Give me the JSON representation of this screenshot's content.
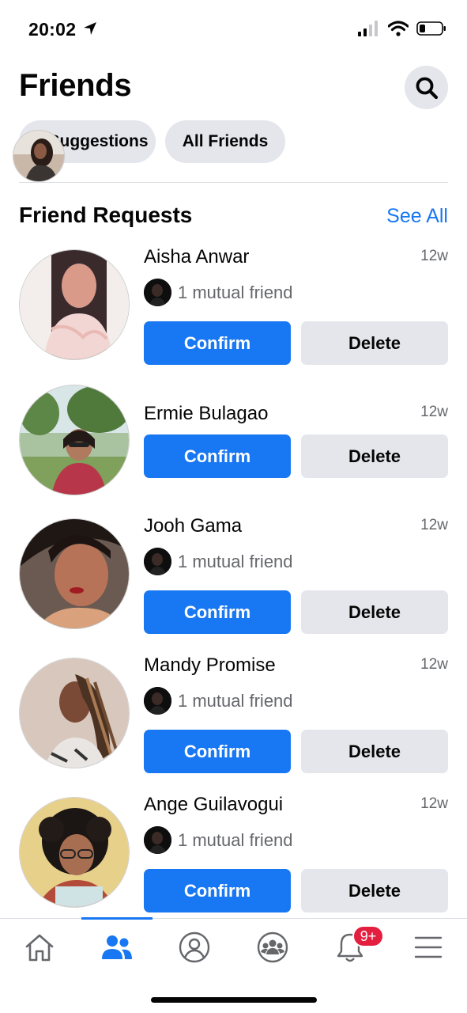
{
  "status_bar": {
    "time": "20:02"
  },
  "header": {
    "title": "Friends"
  },
  "chips": {
    "suggestions": "Suggestions",
    "all_friends": "All Friends"
  },
  "section": {
    "title": "Friend Requests",
    "see_all": "See All"
  },
  "requests": [
    {
      "name": "Aisha Anwar",
      "time": "12w",
      "mutual": "1 mutual friend",
      "confirm": "Confirm",
      "delete": "Delete"
    },
    {
      "name": "Ermie Bulagao",
      "time": "12w",
      "mutual": "",
      "confirm": "Confirm",
      "delete": "Delete"
    },
    {
      "name": "Jooh Gama",
      "time": "12w",
      "mutual": "1 mutual friend",
      "confirm": "Confirm",
      "delete": "Delete"
    },
    {
      "name": "Mandy Promise",
      "time": "12w",
      "mutual": "1 mutual friend",
      "confirm": "Confirm",
      "delete": "Delete"
    },
    {
      "name": "Ange Guilavogui",
      "time": "12w",
      "mutual": "1 mutual friend",
      "confirm": "Confirm",
      "delete": "Delete"
    }
  ],
  "tab_bar": {
    "items": [
      "home-icon",
      "friends-icon",
      "profile-icon",
      "groups-icon",
      "notifications-icon",
      "menu-icon"
    ],
    "notifications_badge": "9+"
  },
  "colors": {
    "accent": "#1877f2",
    "chip_bg": "#e4e6eb",
    "badge": "#e41e3f",
    "secondary_text": "#65676b"
  }
}
